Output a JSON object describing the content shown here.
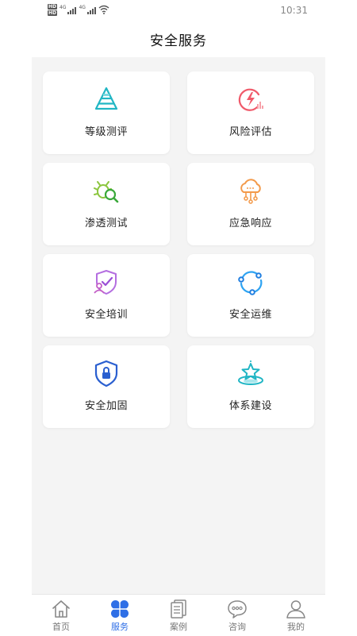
{
  "status_bar": {
    "network_1": "HD",
    "network_2": "HD",
    "signal_label_1": "4G",
    "signal_label_2": "4G",
    "time": "10:31"
  },
  "header": {
    "title": "安全服务"
  },
  "services": [
    {
      "label": "等级测评",
      "icon": "pyramid-icon"
    },
    {
      "label": "风险评估",
      "icon": "risk-lightning-icon"
    },
    {
      "label": "渗透测试",
      "icon": "bug-magnifier-icon"
    },
    {
      "label": "应急响应",
      "icon": "cloud-network-icon"
    },
    {
      "label": "安全培训",
      "icon": "shield-user-check-icon"
    },
    {
      "label": "安全运维",
      "icon": "cycle-nodes-icon"
    },
    {
      "label": "安全加固",
      "icon": "shield-lock-icon"
    },
    {
      "label": "体系建设",
      "icon": "star-platform-icon"
    }
  ],
  "tabbar": {
    "tabs": [
      {
        "label": "首页",
        "icon": "home-icon",
        "active": false
      },
      {
        "label": "服务",
        "icon": "grid-icon",
        "active": true
      },
      {
        "label": "案例",
        "icon": "documents-icon",
        "active": false
      },
      {
        "label": "咨询",
        "icon": "chat-icon",
        "active": false
      },
      {
        "label": "我的",
        "icon": "user-icon",
        "active": false
      }
    ]
  },
  "colors": {
    "accent": "#2f6fe6",
    "background": "#f4f4f4",
    "card": "#ffffff"
  }
}
